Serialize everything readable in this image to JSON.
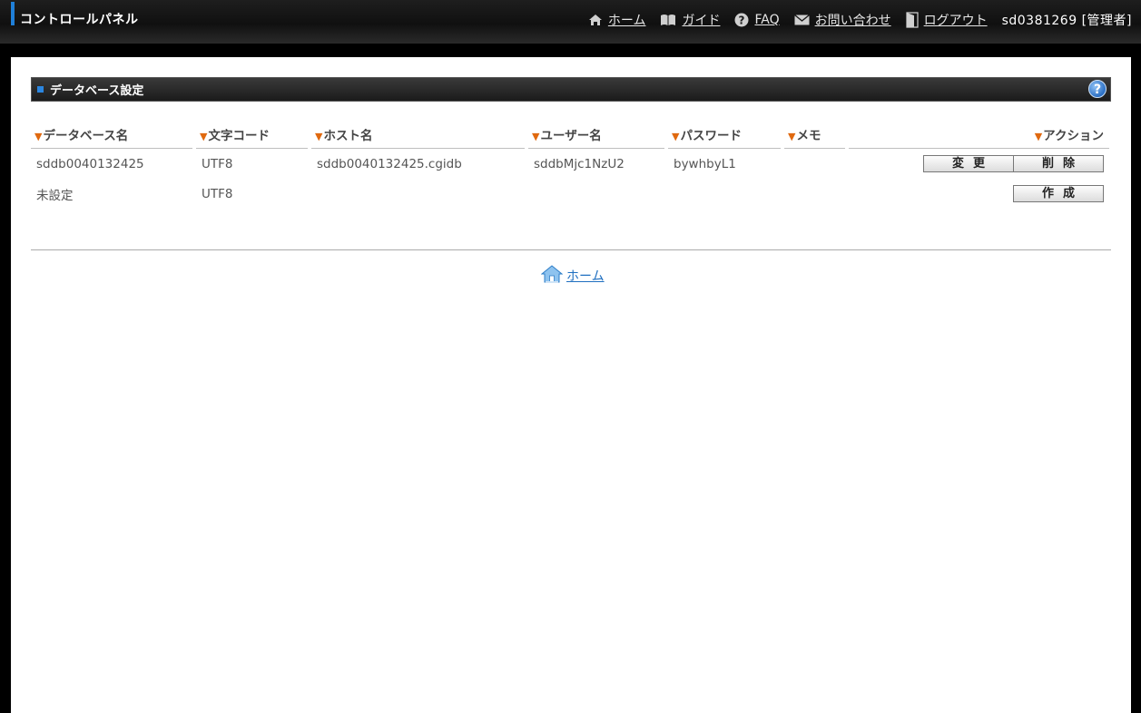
{
  "header": {
    "app_title": "コントロールパネル",
    "nav": {
      "home": "ホーム",
      "guide": "ガイド",
      "faq": "FAQ",
      "contact": "お問い合わせ",
      "logout": "ログアウト",
      "user": "sd0381269 [管理者]"
    }
  },
  "section": {
    "title": "データベース設定",
    "help": "?"
  },
  "table": {
    "columns": {
      "db_name": "データベース名",
      "charset": "文字コード",
      "host": "ホスト名",
      "user": "ユーザー名",
      "password": "パスワード",
      "memo": "メモ",
      "action": "アクション"
    },
    "rows": [
      {
        "db_name": "sddb0040132425",
        "charset": "UTF8",
        "host": "sddb0040132425.cgidb",
        "user": "sddbMjc1NzU2",
        "password": "bywhbyL1",
        "memo": "",
        "edit_label": "変更",
        "delete_label": "削除"
      },
      {
        "db_name": "未設定",
        "charset": "UTF8",
        "host": "",
        "user": "",
        "password": "",
        "memo": "",
        "create_label": "作成"
      }
    ]
  },
  "footer": {
    "home_link": "ホーム"
  },
  "colors": {
    "accent": "#1f7fd8",
    "header_triangle": "#e0690f",
    "link": "#1f6fc0"
  }
}
